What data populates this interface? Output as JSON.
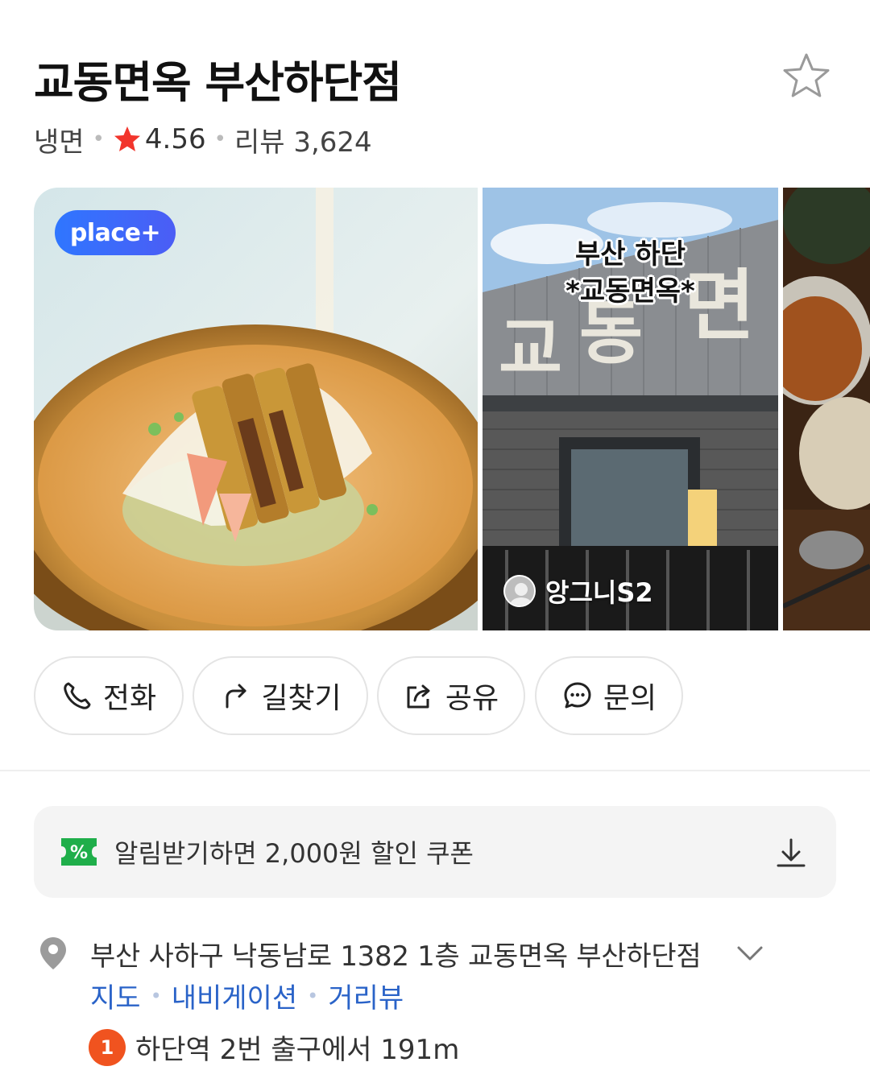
{
  "place": {
    "name": "교동면옥 부산하단점",
    "category": "냉면",
    "rating": "4.56",
    "review_label": "리뷰 3,624"
  },
  "photos": {
    "badge": "place+",
    "caption_line1": "부산 하단",
    "caption_line2": "*교동면옥*",
    "author": "앙그니S2"
  },
  "actions": [
    {
      "label": "전화",
      "icon": "phone-icon"
    },
    {
      "label": "길찾기",
      "icon": "directions-icon"
    },
    {
      "label": "공유",
      "icon": "share-icon"
    },
    {
      "label": "문의",
      "icon": "chat-icon"
    }
  ],
  "coupon": {
    "text": "알림받기하면 2,000원 할인 쿠폰",
    "icon_text": "%"
  },
  "address": {
    "full": "부산 사하구 낙동남로 1382 1층 교동면옥 부산하단점",
    "links": [
      "지도",
      "내비게이션",
      "거리뷰"
    ],
    "station_line": "1",
    "station_text": "하단역 2번 출구에서 191m"
  },
  "colors": {
    "star": "#f2352c",
    "link": "#2a63c8",
    "badge": "#3d6af5",
    "coupon_green": "#1fae4a",
    "line1": "#f0531f"
  }
}
